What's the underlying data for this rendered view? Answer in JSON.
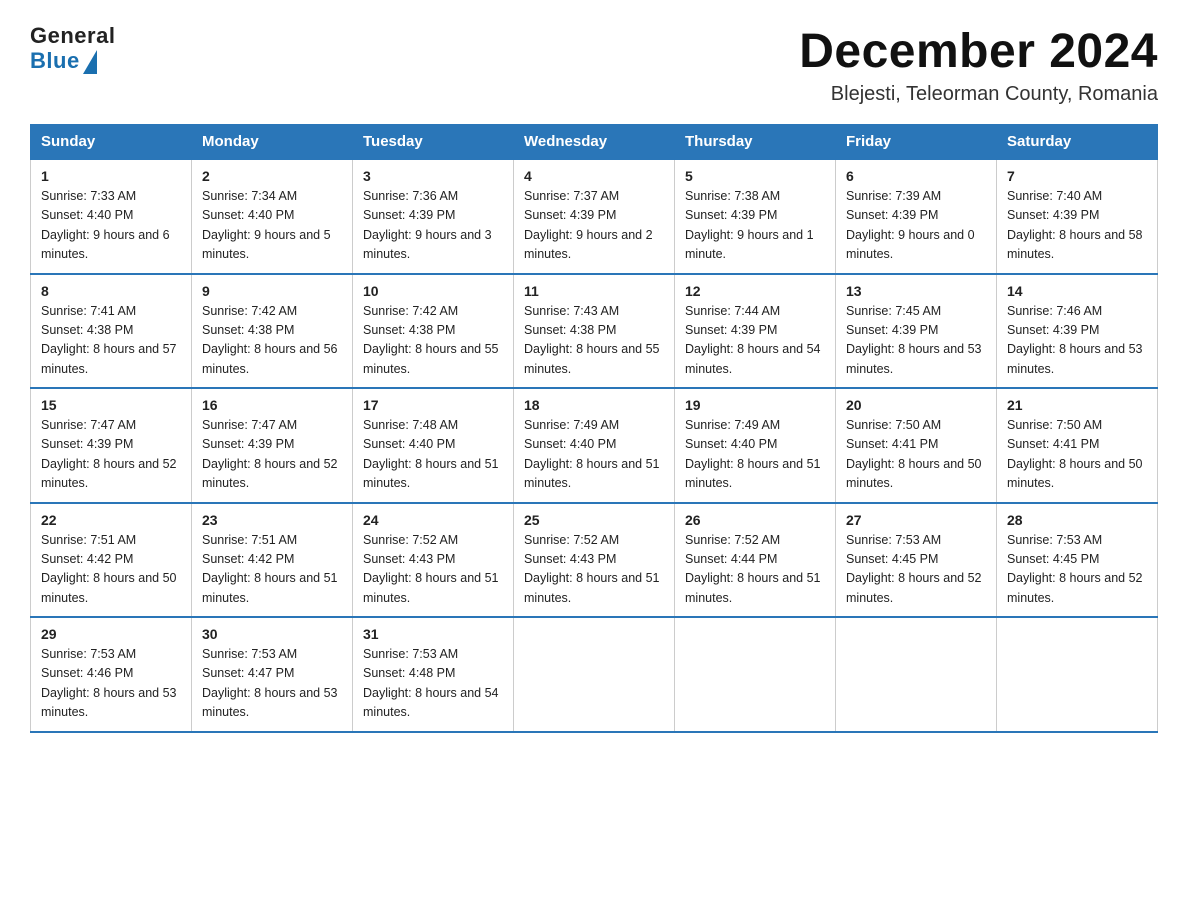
{
  "header": {
    "logo_general": "General",
    "logo_blue": "Blue",
    "title": "December 2024",
    "subtitle": "Blejesti, Teleorman County, Romania"
  },
  "days_of_week": [
    "Sunday",
    "Monday",
    "Tuesday",
    "Wednesday",
    "Thursday",
    "Friday",
    "Saturday"
  ],
  "weeks": [
    [
      {
        "day": "1",
        "sunrise": "7:33 AM",
        "sunset": "4:40 PM",
        "daylight": "9 hours and 6 minutes."
      },
      {
        "day": "2",
        "sunrise": "7:34 AM",
        "sunset": "4:40 PM",
        "daylight": "9 hours and 5 minutes."
      },
      {
        "day": "3",
        "sunrise": "7:36 AM",
        "sunset": "4:39 PM",
        "daylight": "9 hours and 3 minutes."
      },
      {
        "day": "4",
        "sunrise": "7:37 AM",
        "sunset": "4:39 PM",
        "daylight": "9 hours and 2 minutes."
      },
      {
        "day": "5",
        "sunrise": "7:38 AM",
        "sunset": "4:39 PM",
        "daylight": "9 hours and 1 minute."
      },
      {
        "day": "6",
        "sunrise": "7:39 AM",
        "sunset": "4:39 PM",
        "daylight": "9 hours and 0 minutes."
      },
      {
        "day": "7",
        "sunrise": "7:40 AM",
        "sunset": "4:39 PM",
        "daylight": "8 hours and 58 minutes."
      }
    ],
    [
      {
        "day": "8",
        "sunrise": "7:41 AM",
        "sunset": "4:38 PM",
        "daylight": "8 hours and 57 minutes."
      },
      {
        "day": "9",
        "sunrise": "7:42 AM",
        "sunset": "4:38 PM",
        "daylight": "8 hours and 56 minutes."
      },
      {
        "day": "10",
        "sunrise": "7:42 AM",
        "sunset": "4:38 PM",
        "daylight": "8 hours and 55 minutes."
      },
      {
        "day": "11",
        "sunrise": "7:43 AM",
        "sunset": "4:38 PM",
        "daylight": "8 hours and 55 minutes."
      },
      {
        "day": "12",
        "sunrise": "7:44 AM",
        "sunset": "4:39 PM",
        "daylight": "8 hours and 54 minutes."
      },
      {
        "day": "13",
        "sunrise": "7:45 AM",
        "sunset": "4:39 PM",
        "daylight": "8 hours and 53 minutes."
      },
      {
        "day": "14",
        "sunrise": "7:46 AM",
        "sunset": "4:39 PM",
        "daylight": "8 hours and 53 minutes."
      }
    ],
    [
      {
        "day": "15",
        "sunrise": "7:47 AM",
        "sunset": "4:39 PM",
        "daylight": "8 hours and 52 minutes."
      },
      {
        "day": "16",
        "sunrise": "7:47 AM",
        "sunset": "4:39 PM",
        "daylight": "8 hours and 52 minutes."
      },
      {
        "day": "17",
        "sunrise": "7:48 AM",
        "sunset": "4:40 PM",
        "daylight": "8 hours and 51 minutes."
      },
      {
        "day": "18",
        "sunrise": "7:49 AM",
        "sunset": "4:40 PM",
        "daylight": "8 hours and 51 minutes."
      },
      {
        "day": "19",
        "sunrise": "7:49 AM",
        "sunset": "4:40 PM",
        "daylight": "8 hours and 51 minutes."
      },
      {
        "day": "20",
        "sunrise": "7:50 AM",
        "sunset": "4:41 PM",
        "daylight": "8 hours and 50 minutes."
      },
      {
        "day": "21",
        "sunrise": "7:50 AM",
        "sunset": "4:41 PM",
        "daylight": "8 hours and 50 minutes."
      }
    ],
    [
      {
        "day": "22",
        "sunrise": "7:51 AM",
        "sunset": "4:42 PM",
        "daylight": "8 hours and 50 minutes."
      },
      {
        "day": "23",
        "sunrise": "7:51 AM",
        "sunset": "4:42 PM",
        "daylight": "8 hours and 51 minutes."
      },
      {
        "day": "24",
        "sunrise": "7:52 AM",
        "sunset": "4:43 PM",
        "daylight": "8 hours and 51 minutes."
      },
      {
        "day": "25",
        "sunrise": "7:52 AM",
        "sunset": "4:43 PM",
        "daylight": "8 hours and 51 minutes."
      },
      {
        "day": "26",
        "sunrise": "7:52 AM",
        "sunset": "4:44 PM",
        "daylight": "8 hours and 51 minutes."
      },
      {
        "day": "27",
        "sunrise": "7:53 AM",
        "sunset": "4:45 PM",
        "daylight": "8 hours and 52 minutes."
      },
      {
        "day": "28",
        "sunrise": "7:53 AM",
        "sunset": "4:45 PM",
        "daylight": "8 hours and 52 minutes."
      }
    ],
    [
      {
        "day": "29",
        "sunrise": "7:53 AM",
        "sunset": "4:46 PM",
        "daylight": "8 hours and 53 minutes."
      },
      {
        "day": "30",
        "sunrise": "7:53 AM",
        "sunset": "4:47 PM",
        "daylight": "8 hours and 53 minutes."
      },
      {
        "day": "31",
        "sunrise": "7:53 AM",
        "sunset": "4:48 PM",
        "daylight": "8 hours and 54 minutes."
      },
      null,
      null,
      null,
      null
    ]
  ]
}
